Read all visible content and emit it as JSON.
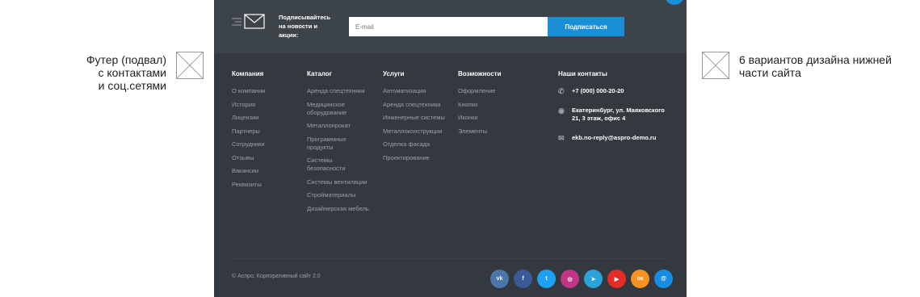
{
  "annotations": {
    "left_lines": [
      "Футер (подвал)",
      "с контактами",
      "и соц.сетями"
    ],
    "right_lines": [
      "6 вариантов дизайна нижней",
      "части сайта"
    ]
  },
  "subscribe": {
    "label_lines": [
      "Подписывайтесь",
      "на новости и",
      "акции:"
    ],
    "email_placeholder": "E-mail",
    "button_label": "Подписаться"
  },
  "columns": [
    {
      "title": "Компания",
      "items": [
        "О компании",
        "История",
        "Лицензии",
        "Партнеры",
        "Сотрудники",
        "Отзывы",
        "Вакансии",
        "Реквизиты"
      ]
    },
    {
      "title": "Каталог",
      "items": [
        "Аренда спецтехники",
        "Медицинское оборудование",
        "Металлопрокат",
        "Программные продукты",
        "Системы безопасности",
        "Системы вентиляции",
        "Стройматериалы",
        "Дизайнерская мебель"
      ]
    },
    {
      "title": "Услуги",
      "items": [
        "Автоматизация",
        "Аренда спецтехники",
        "Инженерные системы",
        "Металлоконструкции",
        "Отделка фасада",
        "Проектирование"
      ]
    },
    {
      "title": "Возможности",
      "items": [
        "Оформление",
        "Кнопки",
        "Иконки",
        "Элементы"
      ]
    }
  ],
  "contacts": {
    "title": "Наши контакты",
    "phone": "+7 (000) 000-20-20",
    "address": "Екатеринбург, ул. Маяковского 21, 3 этаж, офис 4",
    "email": "ekb.no-reply@aspro-demo.ru"
  },
  "copyright": "© Аспро: Корпоративный сайт 2.0",
  "socials": [
    {
      "name": "vk-icon",
      "glyph": "vk",
      "color": "#4a76a8"
    },
    {
      "name": "facebook-icon",
      "glyph": "f",
      "color": "#3b5998"
    },
    {
      "name": "twitter-icon",
      "glyph": "t",
      "color": "#1da1f2"
    },
    {
      "name": "instagram-icon",
      "glyph": "◎",
      "color": "#c13584"
    },
    {
      "name": "telegram-icon",
      "glyph": "➤",
      "color": "#2aa3d9"
    },
    {
      "name": "youtube-icon",
      "glyph": "▶",
      "color": "#e52d27"
    },
    {
      "name": "odnoklassniki-icon",
      "glyph": "ок",
      "color": "#f7931e"
    },
    {
      "name": "mailru-icon",
      "glyph": "@",
      "color": "#168de2"
    }
  ],
  "colors": {
    "footer_bg": "#33393e",
    "subscribe_bg": "#3d4449",
    "accent": "#1a8ed7"
  }
}
